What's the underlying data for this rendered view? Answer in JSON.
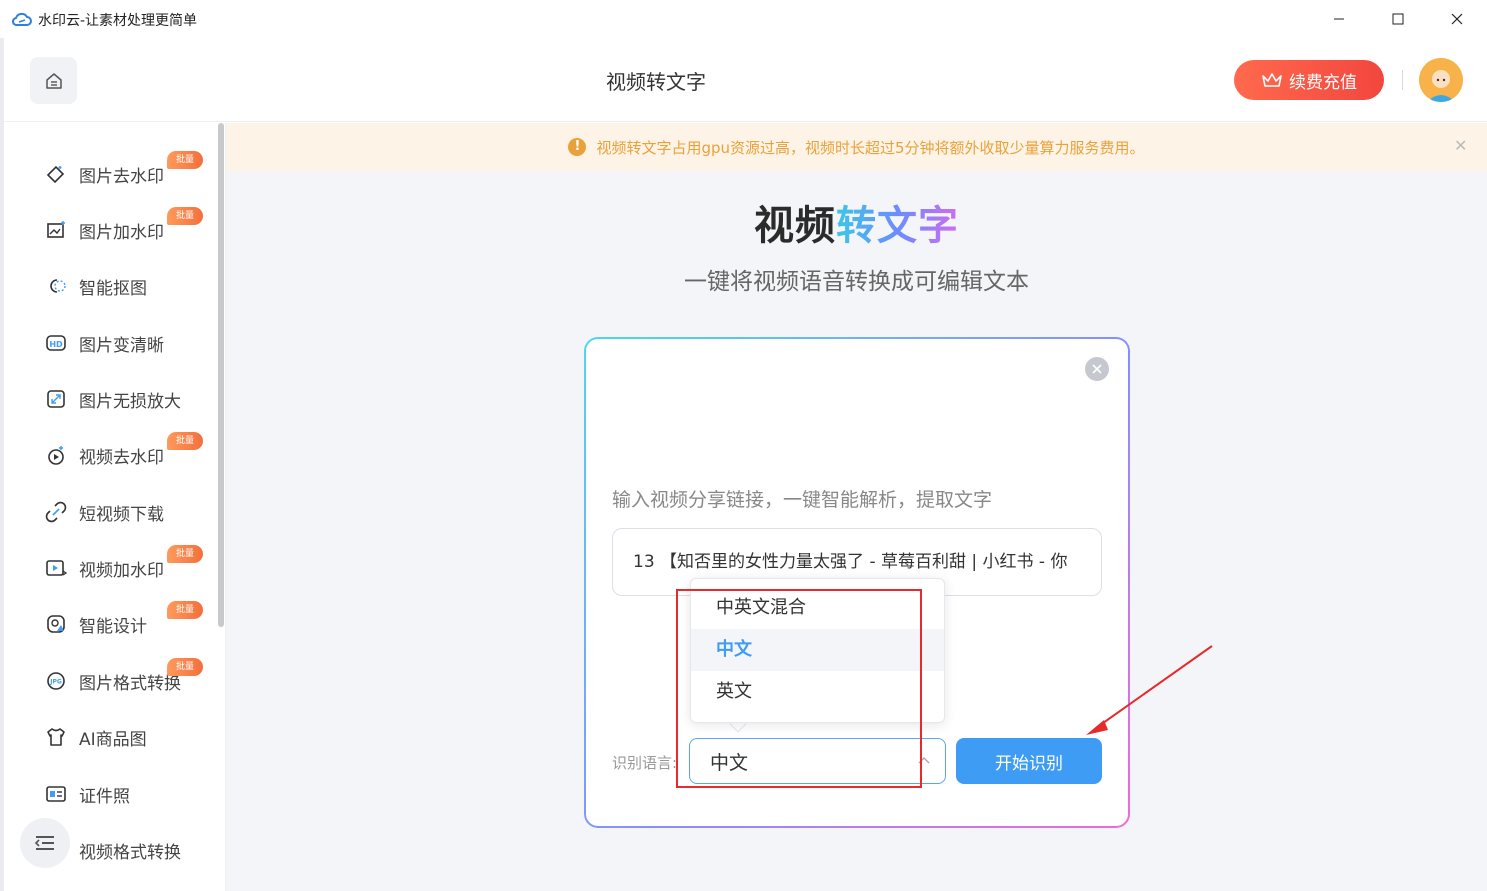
{
  "window": {
    "title": "水印云-让素材处理更简单",
    "controls": [
      "minimize",
      "maximize",
      "close"
    ]
  },
  "header": {
    "title": "视频转文字",
    "vip_button": "续费充值"
  },
  "sidebar": {
    "items": [
      {
        "label": "图片去水印",
        "icon": "eraser-icon",
        "badge": "批量"
      },
      {
        "label": "图片加水印",
        "icon": "image-add-icon",
        "badge": "批量"
      },
      {
        "label": "智能抠图",
        "icon": "cutout-icon",
        "badge": ""
      },
      {
        "label": "图片变清晰",
        "icon": "hd-icon",
        "badge": ""
      },
      {
        "label": "图片无损放大",
        "icon": "enlarge-icon",
        "badge": ""
      },
      {
        "label": "视频去水印",
        "icon": "video-eraser-icon",
        "badge": "批量"
      },
      {
        "label": "短视频下载",
        "icon": "link-icon",
        "badge": ""
      },
      {
        "label": "视频加水印",
        "icon": "video-add-icon",
        "badge": "批量"
      },
      {
        "label": "智能设计",
        "icon": "design-icon",
        "badge": "批量"
      },
      {
        "label": "图片格式转换",
        "icon": "jpg-icon",
        "badge": "批量"
      },
      {
        "label": "AI商品图",
        "icon": "shirt-icon",
        "badge": ""
      },
      {
        "label": "证件照",
        "icon": "id-card-icon",
        "badge": ""
      },
      {
        "label": "视频格式转换",
        "icon": "video-format-icon",
        "badge": ""
      }
    ]
  },
  "notice": {
    "text": "视频转文字占用gpu资源过高，视频时长超过5分钟将额外收取少量算力服务费用。"
  },
  "hero": {
    "title_part1": "视频",
    "title_part2": "转文字",
    "subtitle": "一键将视频语音转换成可编辑文本"
  },
  "card": {
    "hint": "输入视频分享链接，一键智能解析，提取文字",
    "link_value": "13 【知否里的女性力量太强了 - 草莓百利甜 | 小红书 - 你",
    "lang_label": "识别语言:",
    "lang_selected": "中文",
    "start_button": "开始识别"
  },
  "dropdown": {
    "options": [
      "中英文混合",
      "中文",
      "英文"
    ],
    "selected": "中文"
  },
  "colors": {
    "accent": "#3f9cf5",
    "vip": "#f2463f",
    "badge": "#f36f3c",
    "annotation": "#e52b2b"
  }
}
